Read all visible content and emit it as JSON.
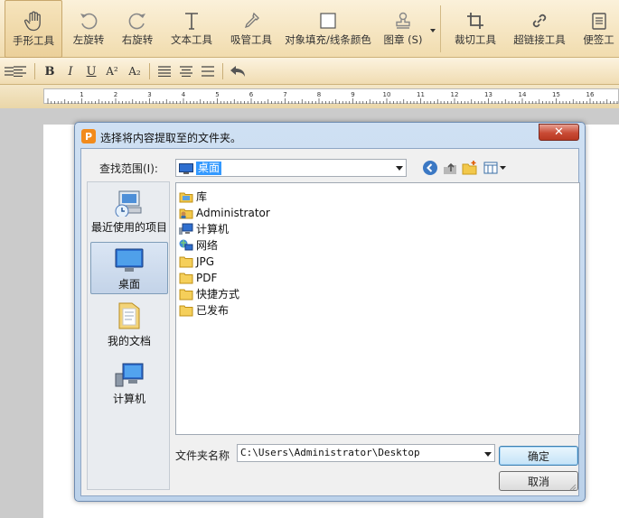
{
  "toolbar": {
    "items": [
      {
        "label": "手形工具",
        "icon": "hand-icon"
      },
      {
        "label": "左旋转",
        "icon": "rotate-left-icon"
      },
      {
        "label": "右旋转",
        "icon": "rotate-right-icon"
      },
      {
        "label": "文本工具",
        "icon": "text-tool-icon"
      },
      {
        "label": "吸管工具",
        "icon": "eyedropper-icon"
      },
      {
        "label": "对象填充/线条颜色",
        "icon": "fill-color-icon"
      },
      {
        "label": "图章 (S)",
        "icon": "stamp-icon"
      },
      {
        "label": "裁切工具",
        "icon": "crop-icon"
      },
      {
        "label": "超链接工具",
        "icon": "link-icon"
      },
      {
        "label": "便签工",
        "icon": "note-icon"
      }
    ]
  },
  "format_bar": {
    "bold": "B",
    "italic": "I",
    "underline": "U",
    "superscript": "A²",
    "subscript": "A₂"
  },
  "ruler": {
    "labels": [
      "1",
      "2",
      "3",
      "4",
      "5",
      "6",
      "7",
      "8",
      "9",
      "10",
      "11",
      "12",
      "13",
      "14",
      "15",
      "16",
      "17"
    ]
  },
  "dialog": {
    "title": "选择将内容提取至的文件夹。",
    "look_in_label": "查找范围(I):",
    "look_in_value": "桌面",
    "places": [
      {
        "label": "最近使用的项目"
      },
      {
        "label": "桌面"
      },
      {
        "label": "我的文档"
      },
      {
        "label": "计算机"
      }
    ],
    "files": [
      {
        "name": "库",
        "icon": "library-icon"
      },
      {
        "name": "Administrator",
        "icon": "user-folder-icon"
      },
      {
        "name": "计算机",
        "icon": "computer-icon"
      },
      {
        "name": "网络",
        "icon": "network-icon"
      },
      {
        "name": "JPG",
        "icon": "folder-icon"
      },
      {
        "name": "PDF",
        "icon": "folder-icon"
      },
      {
        "name": "快捷方式",
        "icon": "folder-icon"
      },
      {
        "name": "已发布",
        "icon": "folder-icon"
      }
    ],
    "folder_name_label": "文件夹名称",
    "folder_name_value": "C:\\Users\\Administrator\\Desktop",
    "ok_label": "确定",
    "cancel_label": "取消"
  }
}
